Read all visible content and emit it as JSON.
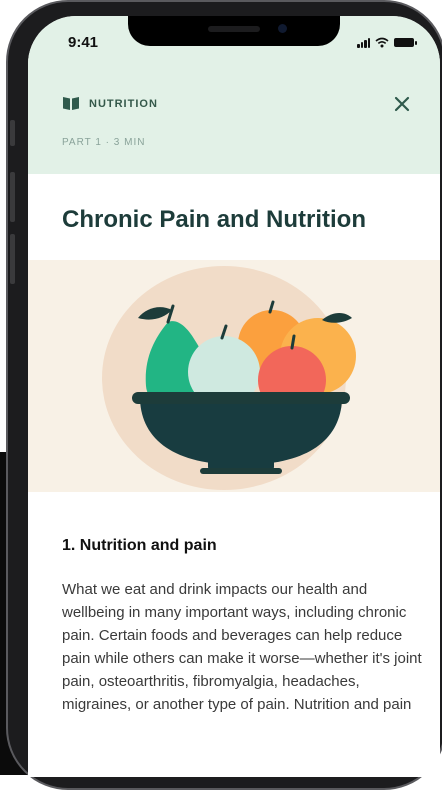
{
  "status_bar": {
    "time": "9:41"
  },
  "header": {
    "category": "NUTRITION",
    "meta": "PART 1 · 3 MIN"
  },
  "article": {
    "title": "Chronic Pain and Nutrition",
    "section_heading": "1. Nutrition and pain",
    "body": "What we eat and drink impacts our health and wellbeing in many important ways, including chronic pain. Certain foods and beverages can help reduce pain while others can make it worse—whether it's joint pain, osteoarthritis, fibromyalgia, headaches, migraines, or another type of pain. Nutrition and pain"
  },
  "icons": {
    "category": "book-icon",
    "close": "close-icon"
  },
  "colors": {
    "header_bg": "#e2f1e7",
    "title": "#1d3c3a",
    "accent": "#2f5a4c",
    "illustration_bg": "#f8f1e6"
  }
}
